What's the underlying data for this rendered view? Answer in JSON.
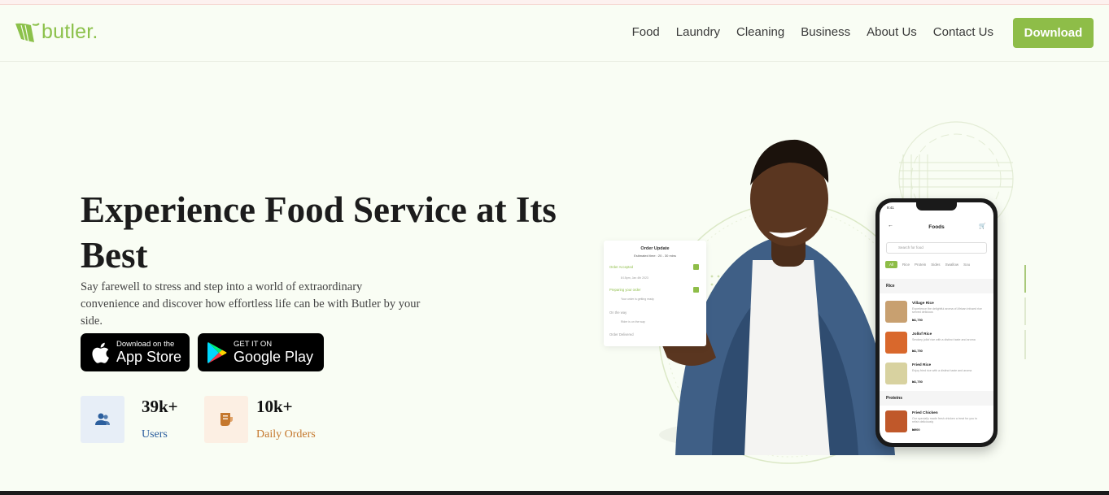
{
  "brand": {
    "name": "butler.",
    "color": "#8cc14b"
  },
  "nav": {
    "items": [
      "Food",
      "Laundry",
      "Cleaning",
      "Business",
      "About Us",
      "Contact Us"
    ],
    "download_label": "Download"
  },
  "hero": {
    "title": "Experience Food Service at Its Best",
    "subtitle": "Say farewell to stress and step into a world of extraordinary convenience and discover how effortless life can be with Butler by your side.",
    "app_store": {
      "small": "Download on the",
      "big": "App Store",
      "icon": "apple-icon"
    },
    "google_play": {
      "small": "GET IT ON",
      "big": "Google Play",
      "icon": "google-play-icon"
    },
    "stats": [
      {
        "value": "39k+",
        "label": "Users",
        "icon": "users-icon",
        "color": "#2c5f9e"
      },
      {
        "value": "10k+",
        "label": "Daily Orders",
        "icon": "receipt-icon",
        "color": "#c5782e"
      }
    ]
  },
  "order_card": {
    "title": "Order Update",
    "estimate": "Estimated time : 20 - 30 mins",
    "steps": [
      {
        "label": "Order Accepted",
        "sub": "8:15pm, Jan 4th 2023",
        "done": true
      },
      {
        "label": "Preparing your order",
        "sub": "Your order is getting ready",
        "done": true
      },
      {
        "label": "On the way",
        "sub": "Rider is on the way",
        "done": false
      },
      {
        "label": "Order Delivered",
        "sub": "",
        "done": false
      }
    ]
  },
  "phone": {
    "time": "9:41",
    "title": "Foods",
    "search_placeholder": "Search for food",
    "tabs": [
      "All",
      "Rice",
      "Protein",
      "Sides",
      "Swallow",
      "Sou"
    ],
    "sections": [
      {
        "name": "Rice",
        "items": [
          {
            "name": "Village Rice",
            "desc": "Experience the delightful aroma of African infused rice served delicious",
            "price": "₦1,750"
          },
          {
            "name": "Jollof Rice",
            "desc": "Smokey jollof rice with a distinct taste and aroma",
            "price": "₦1,750"
          },
          {
            "name": "Fried Rice",
            "desc": "Enjoy fried rice with a distinct taste and aroma",
            "price": "₦1,750"
          }
        ]
      },
      {
        "name": "Proteins",
        "items": [
          {
            "name": "Fried Chicken",
            "desc": "Our specially made fresh chicken a treat for you to relish deliciously",
            "price": "₦900"
          }
        ]
      }
    ]
  }
}
